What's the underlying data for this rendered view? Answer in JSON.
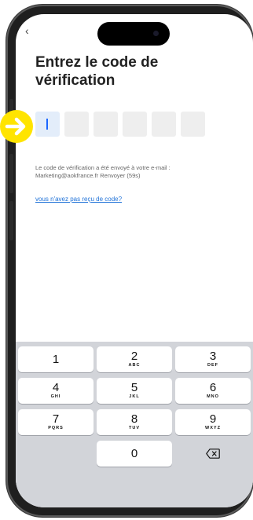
{
  "screen": {
    "back_glyph": "‹",
    "title": "Entrez le code de vérification",
    "code_length": 6,
    "info_line1": "Le code de vérification a été envoyé à votre e-mail :",
    "info_line2": "Marketing@aokfrance.fr  Renvoyer (59s)",
    "resend_link": "vous n'avez pas reçu de code?"
  },
  "keypad": {
    "keys": [
      {
        "digit": "1",
        "letters": ""
      },
      {
        "digit": "2",
        "letters": "ABC"
      },
      {
        "digit": "3",
        "letters": "DEF"
      },
      {
        "digit": "4",
        "letters": "GHI"
      },
      {
        "digit": "5",
        "letters": "JKL"
      },
      {
        "digit": "6",
        "letters": "MNO"
      },
      {
        "digit": "7",
        "letters": "PQRS"
      },
      {
        "digit": "8",
        "letters": "TUV"
      },
      {
        "digit": "9",
        "letters": "WXYZ"
      },
      {
        "digit": "0",
        "letters": ""
      }
    ],
    "delete_icon": "backspace-icon"
  },
  "annotation": {
    "icon": "arrow-right-icon",
    "color": "#ffe400"
  },
  "colors": {
    "link": "#1f72d8",
    "caret": "#1a66ff",
    "keypad_bg": "#d2d4d9"
  }
}
